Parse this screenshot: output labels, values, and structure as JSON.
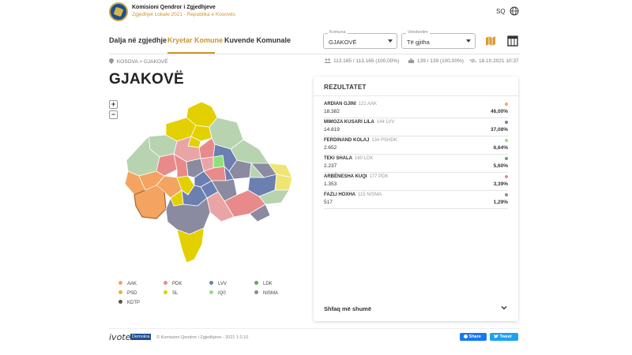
{
  "header": {
    "org_title": "Komisioni Qendror i Zgjedhjeve",
    "org_subtitle": "Zgjedhjet Lokale 2021 - Republika e Kosovës",
    "lang": "SQ"
  },
  "nav": {
    "tabs": [
      {
        "label": "Dalja në zgjedhje",
        "active": false
      },
      {
        "label": "Kryetar Komune",
        "active": true
      },
      {
        "label": "Kuvende Komunale",
        "active": false
      }
    ],
    "komuna": {
      "label": "Komuna",
      "value": "GJAKOVË"
    },
    "vendvotim": {
      "label": "Vendvotim",
      "value": "Të gjitha"
    }
  },
  "info": {
    "breadcrumb_root": "KOSOVA",
    "breadcrumb_sep": ">",
    "breadcrumb_current": "GJAKOVË",
    "voters": "113.165 / 113.165 (100,00%)",
    "stations": "139 / 139 (100,00%)",
    "updated": "18.10.2021 10:37"
  },
  "page": {
    "title": "GJAKOVË"
  },
  "zoom": {
    "in": "+",
    "out": "−"
  },
  "legend": [
    {
      "label": "AAK",
      "color": "#f4a460"
    },
    {
      "label": "PDK",
      "color": "#e88a8a"
    },
    {
      "label": "LVV",
      "color": "#6b7fb0"
    },
    {
      "label": "LDK",
      "color": "#5fa85f"
    },
    {
      "label": "PSD",
      "color": "#f0b030"
    },
    {
      "label": "SL",
      "color": "#e2d000"
    },
    {
      "label": "IQ0",
      "color": "#8fe07a"
    },
    {
      "label": "NISMA",
      "color": "#8a8aa0"
    },
    {
      "label": "KDTP",
      "color": "#555555"
    }
  ],
  "results": {
    "title": "REZULTATET",
    "candidates": [
      {
        "name": "ARDIAN GJINI",
        "party": "121 AAK",
        "votes": "18.382",
        "pct": "46,00%",
        "color": "#f4a460"
      },
      {
        "name": "MIMOZA KUSARI LILA",
        "party": "144 LVV",
        "votes": "14.819",
        "pct": "37,08%",
        "color": "#6b7fb0"
      },
      {
        "name": "FERDINAND KOLAJ",
        "party": "134 PSHDK",
        "votes": "2.652",
        "pct": "6,64%",
        "color": "#8fe07a"
      },
      {
        "name": "TEKI SHALA",
        "party": "160 LDK",
        "votes": "2.237",
        "pct": "5,60%",
        "color": "#5fa85f"
      },
      {
        "name": "ARBËNESHA KUQI",
        "party": "177 PDK",
        "votes": "1.353",
        "pct": "3,39%",
        "color": "#e88a8a"
      },
      {
        "name": "FAZLI HOXHA",
        "party": "115 NISMA",
        "votes": "517",
        "pct": "1,29%",
        "color": "#8a8aa0"
      }
    ],
    "show_more": "Shfaq më shumë"
  },
  "footer": {
    "brand": "ivote",
    "brand_badge": "Demokra",
    "copyright": "© Komisioni Qendror i Zgjedhjeve - 2021 1.0.10",
    "share_fb": "Share",
    "share_tw": "Tweet"
  }
}
